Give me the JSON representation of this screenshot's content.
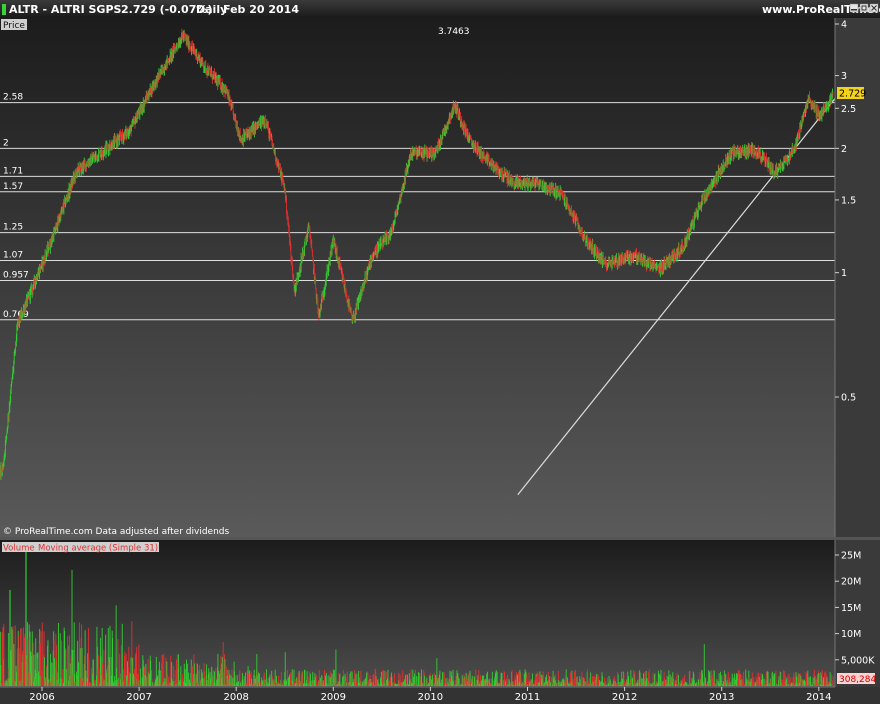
{
  "header": {
    "symbol_title": "ALTR - ALTRI SGPS",
    "last_change": "2.729 (-0.07%)",
    "period": "Daily",
    "date": "Feb 20 2014",
    "brand": "www.ProRealTime.com",
    "window_buttons": [
      "minimize-button",
      "restore-button",
      "close-button"
    ]
  },
  "price_panel": {
    "label": "Price",
    "max_annotation": "3.7463",
    "footer_text": "© ProRealTime.com  Data adjusted after dividends",
    "last_price": "2.729"
  },
  "volume_panel": {
    "label_volume": "Volume",
    "label_ma": "Moving average (Simple 31)",
    "last_value": "308,284"
  },
  "colors": {
    "up": "#33cc33",
    "down": "#e03030",
    "level_line": "#dddddd",
    "trend_line": "#dddddd",
    "last_price_bg": "#f2d21b",
    "panel_bg_top": "#1c1c1c",
    "panel_bg_bottom": "#5a5a5a"
  },
  "chart_data": [
    {
      "type": "line",
      "subtype": "ohlc-bars",
      "scale": "log",
      "y_ticks": [
        "0.5",
        "1",
        "1.5",
        "2",
        "2.5",
        "3",
        "4"
      ],
      "x_ticks": [
        "2006",
        "2007",
        "2008",
        "2009",
        "2010",
        "2011",
        "2012",
        "2013",
        "2014"
      ],
      "horizontal_levels": [
        {
          "label": "2.58",
          "value": 2.58
        },
        {
          "label": "2",
          "value": 2.0
        },
        {
          "label": "1.71",
          "value": 1.71
        },
        {
          "label": "1.57",
          "value": 1.57
        },
        {
          "label": "1.25",
          "value": 1.25
        },
        {
          "label": "1.07",
          "value": 1.07
        },
        {
          "label": "0.957",
          "value": 0.957
        },
        {
          "label": "0.769",
          "value": 0.769
        }
      ],
      "max_marker": {
        "x": 2007.45,
        "y": 3.7463
      },
      "trend_line": [
        {
          "x": 2010.9,
          "y": 0.29
        },
        {
          "x": 2014.38,
          "y": 3.05
        }
      ],
      "key_points": [
        {
          "x": 2005.4,
          "y": 0.29
        },
        {
          "x": 2005.6,
          "y": 0.34
        },
        {
          "x": 2005.75,
          "y": 0.75
        },
        {
          "x": 2006.1,
          "y": 1.2
        },
        {
          "x": 2006.35,
          "y": 1.75
        },
        {
          "x": 2006.6,
          "y": 1.95
        },
        {
          "x": 2006.9,
          "y": 2.2
        },
        {
          "x": 2007.15,
          "y": 2.85
        },
        {
          "x": 2007.45,
          "y": 3.75
        },
        {
          "x": 2007.7,
          "y": 3.1
        },
        {
          "x": 2007.9,
          "y": 2.75
        },
        {
          "x": 2008.05,
          "y": 2.1
        },
        {
          "x": 2008.3,
          "y": 2.35
        },
        {
          "x": 2008.5,
          "y": 1.6
        },
        {
          "x": 2008.6,
          "y": 0.9
        },
        {
          "x": 2008.75,
          "y": 1.3
        },
        {
          "x": 2008.85,
          "y": 0.78
        },
        {
          "x": 2009.0,
          "y": 1.2
        },
        {
          "x": 2009.2,
          "y": 0.76
        },
        {
          "x": 2009.4,
          "y": 1.1
        },
        {
          "x": 2009.6,
          "y": 1.25
        },
        {
          "x": 2009.8,
          "y": 1.95
        },
        {
          "x": 2010.05,
          "y": 1.95
        },
        {
          "x": 2010.25,
          "y": 2.55
        },
        {
          "x": 2010.4,
          "y": 2.1
        },
        {
          "x": 2010.6,
          "y": 1.85
        },
        {
          "x": 2010.85,
          "y": 1.65
        },
        {
          "x": 2011.1,
          "y": 1.65
        },
        {
          "x": 2011.35,
          "y": 1.55
        },
        {
          "x": 2011.6,
          "y": 1.2
        },
        {
          "x": 2011.8,
          "y": 1.05
        },
        {
          "x": 2012.1,
          "y": 1.1
        },
        {
          "x": 2012.35,
          "y": 1.02
        },
        {
          "x": 2012.6,
          "y": 1.15
        },
        {
          "x": 2012.8,
          "y": 1.5
        },
        {
          "x": 2013.1,
          "y": 1.95
        },
        {
          "x": 2013.35,
          "y": 1.98
        },
        {
          "x": 2013.55,
          "y": 1.75
        },
        {
          "x": 2013.75,
          "y": 2.0
        },
        {
          "x": 2013.9,
          "y": 2.65
        },
        {
          "x": 2014.0,
          "y": 2.4
        },
        {
          "x": 2014.1,
          "y": 2.55
        },
        {
          "x": 2014.15,
          "y": 2.73
        }
      ]
    },
    {
      "type": "bar",
      "scale": "linear",
      "y_ticks": [
        "5,000K",
        "10M",
        "15M",
        "20M",
        "25M"
      ],
      "y_tick_values": [
        5000000,
        10000000,
        15000000,
        20000000,
        25000000
      ],
      "x_ticks": [
        "2006",
        "2007",
        "2008",
        "2009",
        "2010",
        "2011",
        "2012",
        "2013",
        "2014"
      ],
      "last_value": "308,284"
    }
  ]
}
